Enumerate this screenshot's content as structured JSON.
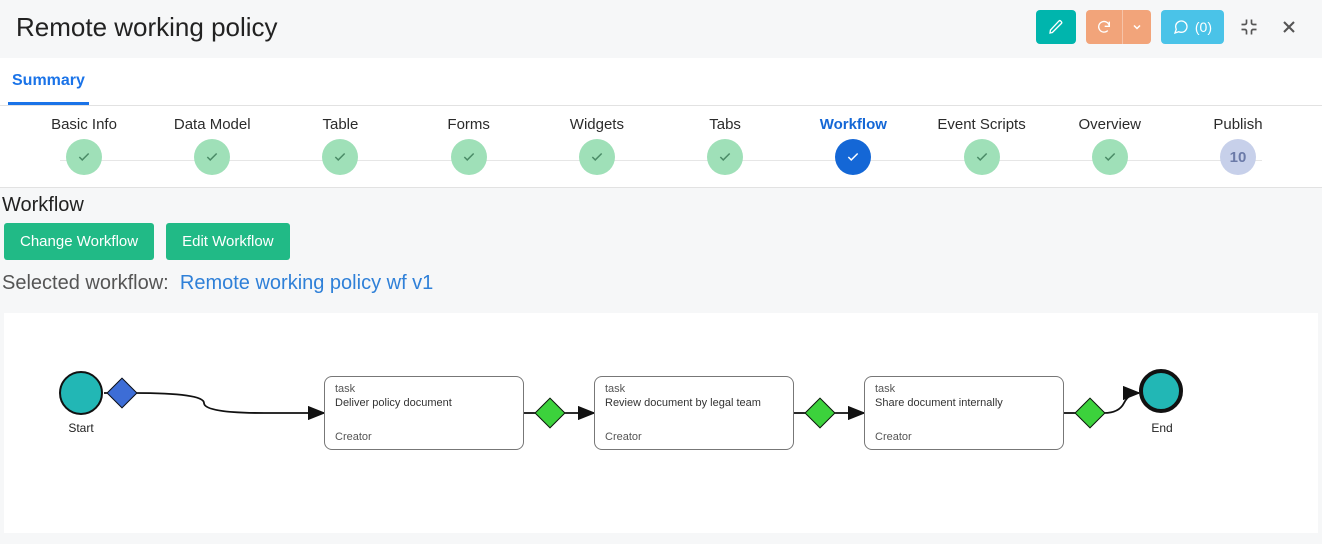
{
  "header": {
    "title": "Remote working policy",
    "comments_count": 0
  },
  "tabs": [
    {
      "label": "Summary",
      "active": true
    }
  ],
  "steps": [
    {
      "label": "Basic Info",
      "state": "done"
    },
    {
      "label": "Data Model",
      "state": "done"
    },
    {
      "label": "Table",
      "state": "done"
    },
    {
      "label": "Forms",
      "state": "done"
    },
    {
      "label": "Widgets",
      "state": "done"
    },
    {
      "label": "Tabs",
      "state": "done"
    },
    {
      "label": "Workflow",
      "state": "active"
    },
    {
      "label": "Event Scripts",
      "state": "done"
    },
    {
      "label": "Overview",
      "state": "done"
    },
    {
      "label": "Publish",
      "state": "num",
      "num": "10"
    }
  ],
  "section": {
    "title": "Workflow",
    "change_btn": "Change Workflow",
    "edit_btn": "Edit Workflow",
    "selected_label": "Selected workflow:",
    "selected_name": "Remote working policy wf v1"
  },
  "workflow": {
    "start_label": "Start",
    "end_label": "End",
    "tasks": [
      {
        "type": "task",
        "title": "Deliver policy document",
        "role": "Creator"
      },
      {
        "type": "task",
        "title": "Review document by legal team",
        "role": "Creator"
      },
      {
        "type": "task",
        "title": "Share document internally",
        "role": "Creator"
      }
    ]
  },
  "colors": {
    "teal": "#00b5ad",
    "orange": "#f2a47a",
    "lightblue": "#4ac3e8",
    "green_btn": "#21ba86",
    "link": "#2f80d8",
    "step_active": "#1467d6"
  }
}
